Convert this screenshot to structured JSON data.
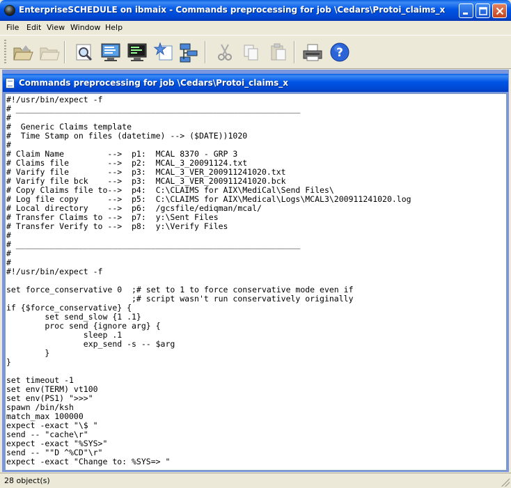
{
  "window": {
    "title": "EnterpriseSCHEDULE on ibmaix  - Commands preprocessing for job \\Cedars\\Protoi_claims_x"
  },
  "menu": [
    "File",
    "Edit",
    "View",
    "Window",
    "Help"
  ],
  "toolbar": {
    "icons": [
      "open-folder-icon",
      "folder-icon",
      "find-icon",
      "monitor-icon",
      "display-icon",
      "star-document-icon",
      "tree-icon",
      "cut-icon",
      "copy-icon",
      "paste-icon",
      "print-icon",
      "help-icon"
    ]
  },
  "child_window": {
    "title": "Commands preprocessing for job \\Cedars\\Protoi_claims_x"
  },
  "editor": {
    "lines": [
      "#!/usr/bin/expect -f",
      "# ___________________________________________________________",
      "#",
      "#  Generic Claims template",
      "#  Time Stamp on files (datetime) --> ($DATE))1020",
      "#",
      "# Claim Name         -->  p1:  MCAL 8370 - GRP 3",
      "# Claims file        -->  p2:  MCAL_3_20091124.txt",
      "# Varify file        -->  p3:  MCAL_3_VER_200911241020.txt",
      "# Varify file bck    -->  p3:  MCAL_3_VER_200911241020.bck",
      "# Copy Claims file to-->  p4:  C:\\CLAIMS for AIX\\MediCal\\Send Files\\",
      "# Log file copy      -->  p5:  C:\\CLAIMS for AIX\\Medical\\Logs\\MCAL3\\200911241020.log",
      "# Local directory    -->  p6:  /gcsfile/ediqman/mcal/",
      "# Transfer Claims to -->  p7:  y:\\Sent Files",
      "# Transfer Verify to -->  p8:  y:\\Verify Files",
      "#",
      "# ___________________________________________________________",
      "#",
      "#",
      "#!/usr/bin/expect -f",
      "",
      "set force_conservative 0  ;# set to 1 to force conservative mode even if",
      "                          ;# script wasn't run conservatively originally",
      "if {$force_conservative} {",
      "        set send_slow {1 .1}",
      "        proc send {ignore arg} {",
      "                sleep .1",
      "                exp_send -s -- $arg",
      "        }",
      "}",
      "",
      "set timeout -1",
      "set env(TERM) vt100",
      "set env(PS1) \">>>\"",
      "spawn /bin/ksh",
      "match_max 100000",
      "expect -exact \"\\$ \"",
      "send -- \"cache\\r\"",
      "expect -exact \"%SYS>\"",
      "send -- \"\"D ^%CD\"\\r\"",
      "expect -exact \"Change to: %SYS=> \""
    ]
  },
  "status": {
    "text": "28 object(s)"
  }
}
